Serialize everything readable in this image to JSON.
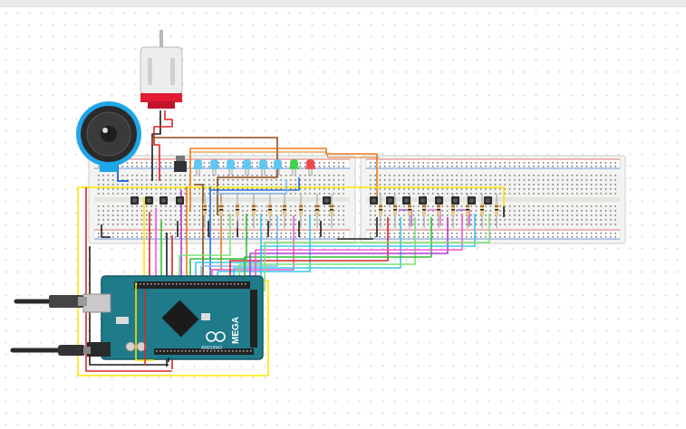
{
  "app": {
    "canvas_background": "#ffffff",
    "top_bar_color": "#e9e9ec"
  },
  "board": {
    "label_brand": "MEGA",
    "label_sub": "ARDUINO",
    "color": "#1f7a8a",
    "dark_color": "#135764"
  },
  "components": {
    "dc_motor": "motor-icon",
    "speaker": "speaker-icon",
    "usb_cable": "usb-cable",
    "power_cable": "dc-barrel-cable",
    "led_colors": [
      "#5ec8f0",
      "#5ec8f0",
      "#5ec8f0",
      "#5ec8f0",
      "#5ec8f0",
      "#5ec8f0",
      "#3fd24a",
      "#f04a4a"
    ],
    "button_count_left": 4,
    "button_count_right": 8
  },
  "wire_colors": {
    "red": "#d8262a",
    "black": "#1b1b1b",
    "yellow": "#ffe600",
    "orange": "#e8791a",
    "brown": "#8a4a1a",
    "blue": "#2c6fe0",
    "cyan": "#38c8e8",
    "green": "#2fbf3a",
    "purple": "#b13ad8",
    "pink": "#ef5bd0",
    "light_green": "#7fe07a",
    "light_blue": "#82b8f0"
  }
}
